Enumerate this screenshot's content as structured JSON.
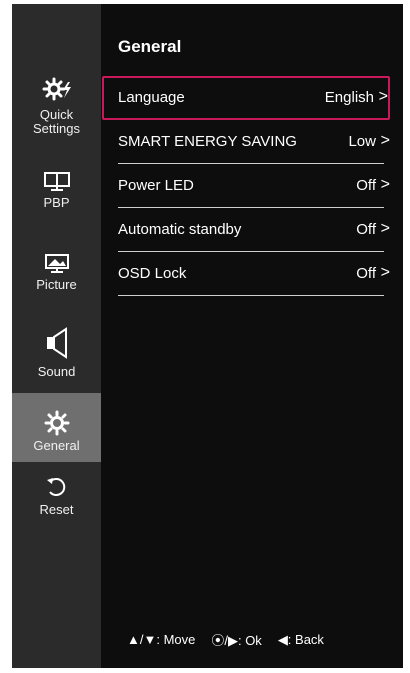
{
  "sidebar": {
    "items": [
      {
        "label_line1": "Quick",
        "label_line2": "Settings",
        "icon": "quick-settings-icon",
        "active": false
      },
      {
        "label": "PBP",
        "icon": "pbp-icon",
        "active": false
      },
      {
        "label": "Picture",
        "icon": "picture-icon",
        "active": false
      },
      {
        "label": "Sound",
        "icon": "sound-icon",
        "active": false
      },
      {
        "label": "General",
        "icon": "gear-icon",
        "active": true
      },
      {
        "label": "Reset",
        "icon": "reset-icon",
        "active": false
      }
    ]
  },
  "main": {
    "title": "General",
    "rows": [
      {
        "name": "Language",
        "value": "English",
        "selected": true
      },
      {
        "name": "SMART ENERGY SAVING",
        "value": "Low",
        "selected": false
      },
      {
        "name": "Power LED",
        "value": "Off",
        "selected": false
      },
      {
        "name": "Automatic standby",
        "value": "Off",
        "selected": false
      },
      {
        "name": "OSD Lock",
        "value": "Off",
        "selected": false
      }
    ],
    "chevron": ">"
  },
  "footer": {
    "move": "▲/▼: Move",
    "ok": "⦿/▶: Ok",
    "back": "◀: Back"
  },
  "colors": {
    "panel_bg": "#0d0d0d",
    "sidebar_bg": "#2b2b2b",
    "active_bg": "#6f6f6f",
    "highlight_border": "#c8195a"
  }
}
